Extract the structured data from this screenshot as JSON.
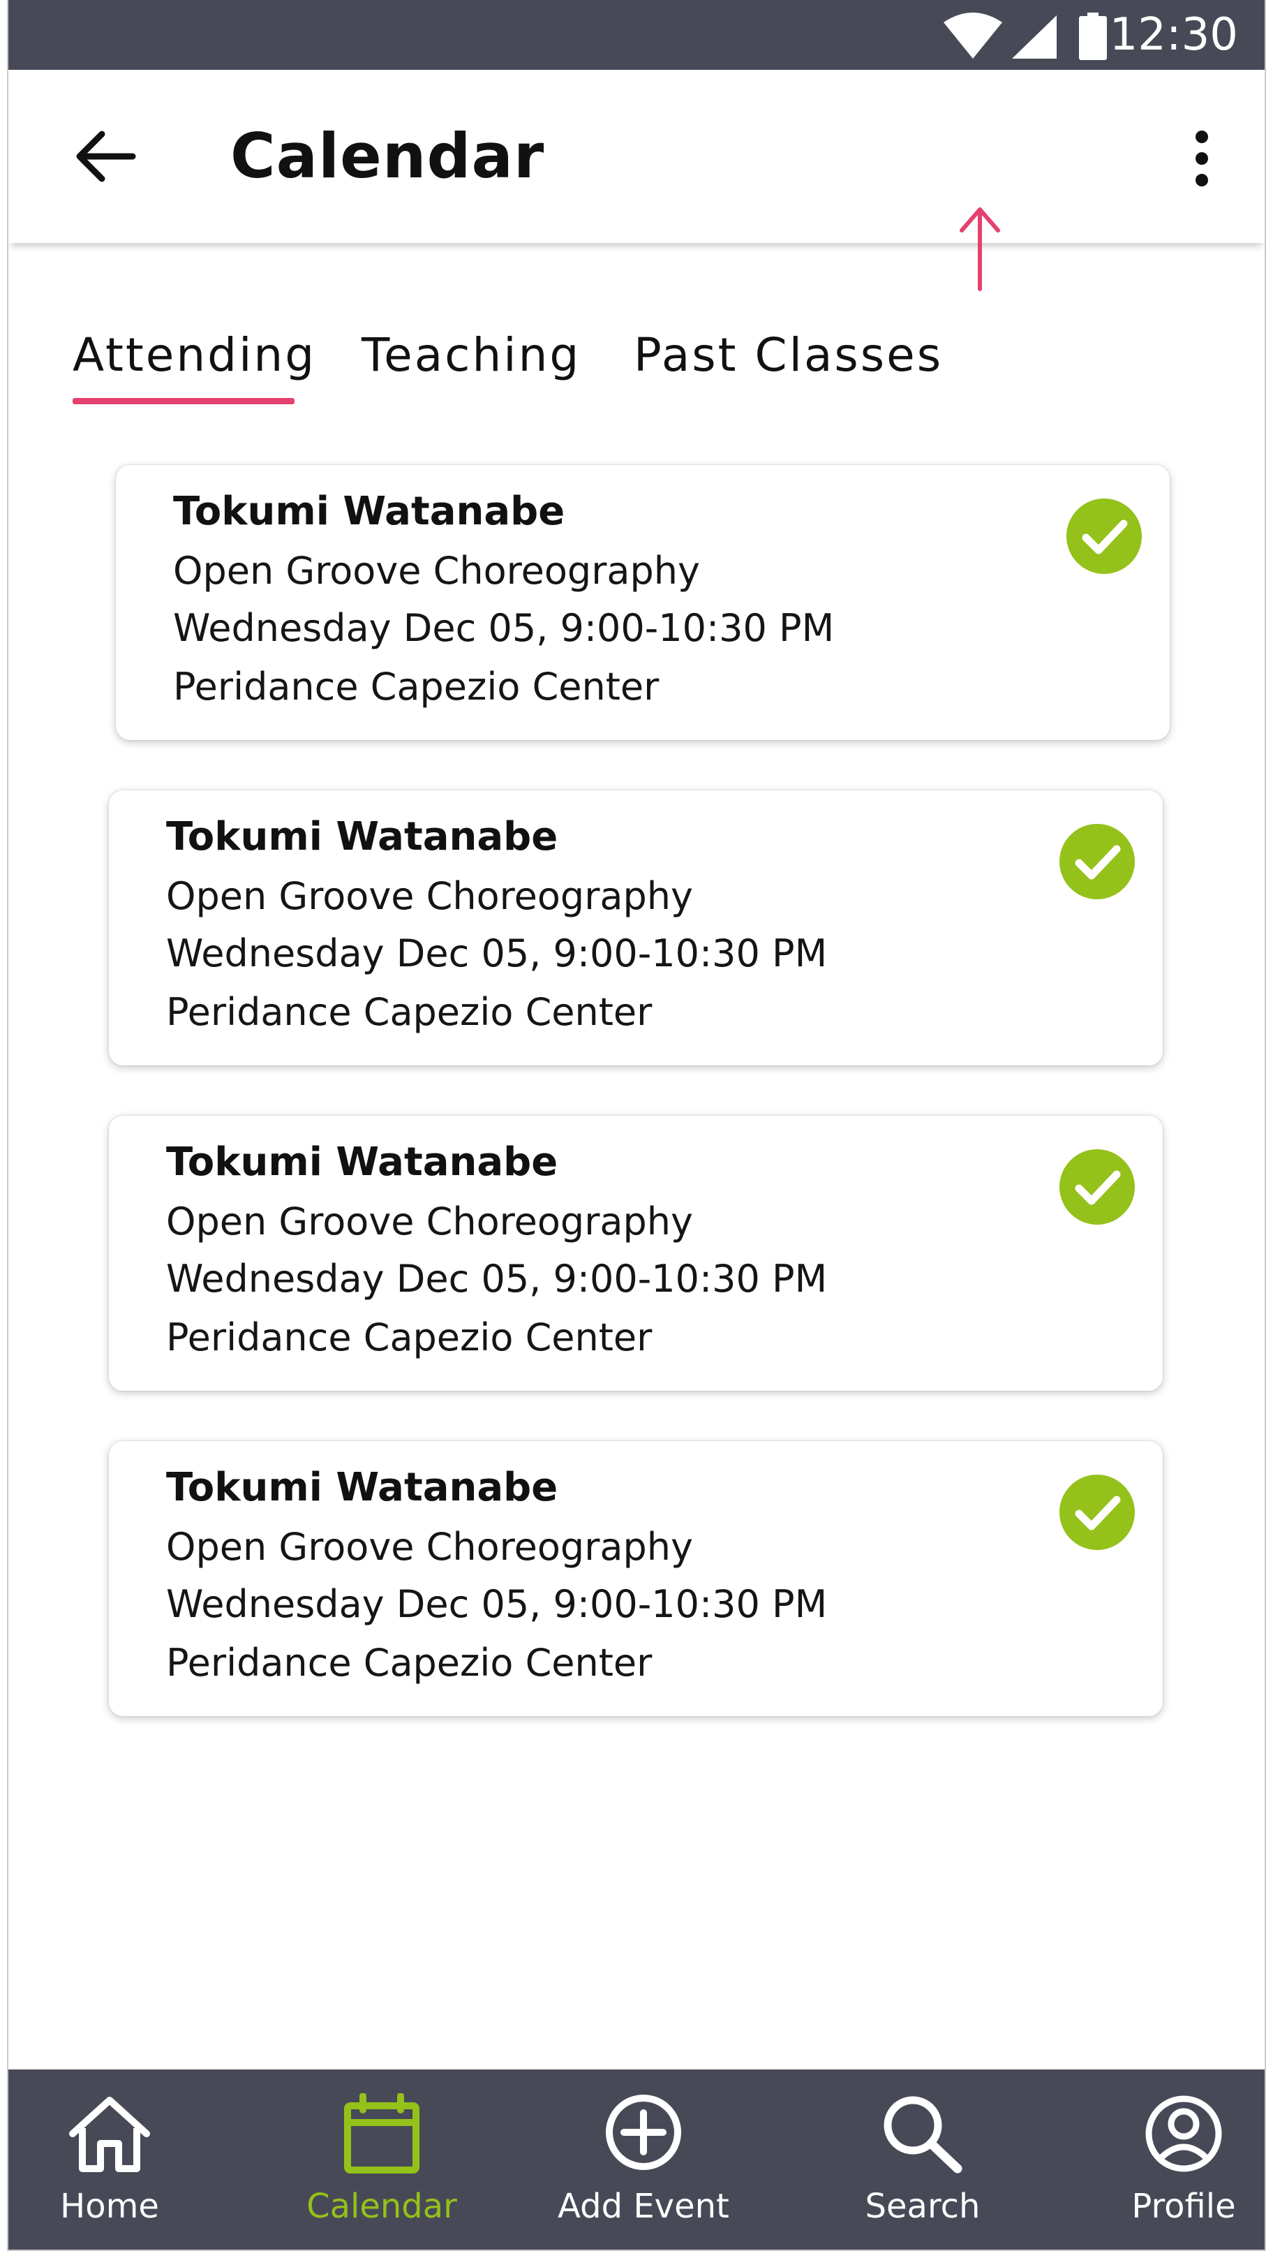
{
  "status_bar": {
    "time": "12:30"
  },
  "app_bar": {
    "title": "Calendar"
  },
  "tabs": [
    {
      "label": "Attending",
      "active": true
    },
    {
      "label": "Teaching",
      "active": false
    },
    {
      "label": "Past Classes",
      "active": false
    }
  ],
  "events": [
    {
      "name": "Tokumi Watanabe",
      "class": "Open Groove Choreography",
      "time": "Wednesday Dec 05, 9:00-10:30 PM",
      "location": "Peridance Capezio Center",
      "status_icon": "check-circle-icon"
    },
    {
      "name": "Tokumi Watanabe",
      "class": "Open Groove Choreography",
      "time": "Wednesday Dec 05, 9:00-10:30 PM",
      "location": "Peridance Capezio Center",
      "status_icon": "check-circle-icon"
    },
    {
      "name": "Tokumi Watanabe",
      "class": "Open Groove Choreography",
      "time": "Wednesday Dec 05, 9:00-10:30 PM",
      "location": "Peridance Capezio Center",
      "status_icon": "check-circle-icon"
    },
    {
      "name": "Tokumi Watanabe",
      "class": "Open Groove Choreography",
      "time": "Wednesday Dec 05, 9:00-10:30 PM",
      "location": "Peridance Capezio Center",
      "status_icon": "check-circle-icon"
    }
  ],
  "bottom_nav": [
    {
      "label": "Home",
      "icon": "home-icon",
      "active": false
    },
    {
      "label": "Calendar",
      "icon": "calendar-icon",
      "active": true
    },
    {
      "label": "Add Event",
      "icon": "add-circle-icon",
      "active": false
    },
    {
      "label": "Search",
      "icon": "search-icon",
      "active": false
    },
    {
      "label": "Profile",
      "icon": "profile-icon",
      "active": false
    }
  ],
  "colors": {
    "bar_background": "#474a56",
    "accent_green": "#94c11a",
    "tab_indicator_pink": "#e4416f",
    "annotation_arrow": "#e4416f"
  }
}
